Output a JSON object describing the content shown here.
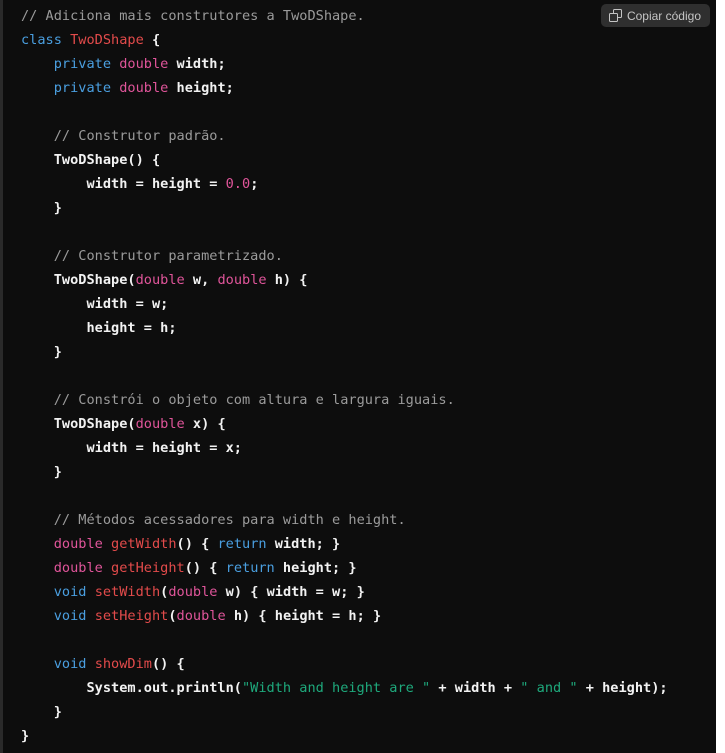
{
  "code_block": {
    "language": "java",
    "background_color": "#0d0d0d",
    "copy_button": {
      "label": "Copiar código",
      "icon": "copy-icon",
      "background_color": "#2f2f2f",
      "text_color": "#c5c5c5"
    },
    "syntax_colors": {
      "comment": "#9b9b9b",
      "keyword": "#4a9fe0",
      "type": "#e0559a",
      "class_name": "#e34b4b",
      "function": "#e34b4b",
      "string": "#1ea97c",
      "number": "#e0559a",
      "plain": "#f2f2f2"
    },
    "lines": [
      {
        "indent": 0,
        "tokens": [
          {
            "t": "comment",
            "v": "// Adiciona mais construtores a TwoDShape."
          }
        ]
      },
      {
        "indent": 0,
        "tokens": [
          {
            "t": "keyword",
            "v": "class"
          },
          {
            "t": "plain",
            "v": " "
          },
          {
            "t": "classname",
            "v": "TwoDShape"
          },
          {
            "t": "plain",
            "v": " {"
          }
        ]
      },
      {
        "indent": 1,
        "tokens": [
          {
            "t": "keyword",
            "v": "private"
          },
          {
            "t": "plain",
            "v": " "
          },
          {
            "t": "type",
            "v": "double"
          },
          {
            "t": "plain",
            "v": " width;"
          }
        ]
      },
      {
        "indent": 1,
        "tokens": [
          {
            "t": "keyword",
            "v": "private"
          },
          {
            "t": "plain",
            "v": " "
          },
          {
            "t": "type",
            "v": "double"
          },
          {
            "t": "plain",
            "v": " height;"
          }
        ]
      },
      {
        "indent": 0,
        "tokens": []
      },
      {
        "indent": 1,
        "tokens": [
          {
            "t": "comment",
            "v": "// Construtor padrão."
          }
        ]
      },
      {
        "indent": 1,
        "tokens": [
          {
            "t": "plain",
            "v": "TwoDShape() {"
          }
        ]
      },
      {
        "indent": 2,
        "tokens": [
          {
            "t": "plain",
            "v": "width = height = "
          },
          {
            "t": "number",
            "v": "0.0"
          },
          {
            "t": "plain",
            "v": ";"
          }
        ]
      },
      {
        "indent": 1,
        "tokens": [
          {
            "t": "plain",
            "v": "}"
          }
        ]
      },
      {
        "indent": 0,
        "tokens": []
      },
      {
        "indent": 1,
        "tokens": [
          {
            "t": "comment",
            "v": "// Construtor parametrizado."
          }
        ]
      },
      {
        "indent": 1,
        "tokens": [
          {
            "t": "plain",
            "v": "TwoDShape("
          },
          {
            "t": "type",
            "v": "double"
          },
          {
            "t": "plain",
            "v": " w, "
          },
          {
            "t": "type",
            "v": "double"
          },
          {
            "t": "plain",
            "v": " h) {"
          }
        ]
      },
      {
        "indent": 2,
        "tokens": [
          {
            "t": "plain",
            "v": "width = w;"
          }
        ]
      },
      {
        "indent": 2,
        "tokens": [
          {
            "t": "plain",
            "v": "height = h;"
          }
        ]
      },
      {
        "indent": 1,
        "tokens": [
          {
            "t": "plain",
            "v": "}"
          }
        ]
      },
      {
        "indent": 0,
        "tokens": []
      },
      {
        "indent": 1,
        "tokens": [
          {
            "t": "comment",
            "v": "// Constrói o objeto com altura e largura iguais."
          }
        ]
      },
      {
        "indent": 1,
        "tokens": [
          {
            "t": "plain",
            "v": "TwoDShape("
          },
          {
            "t": "type",
            "v": "double"
          },
          {
            "t": "plain",
            "v": " x) {"
          }
        ]
      },
      {
        "indent": 2,
        "tokens": [
          {
            "t": "plain",
            "v": "width = height = x;"
          }
        ]
      },
      {
        "indent": 1,
        "tokens": [
          {
            "t": "plain",
            "v": "}"
          }
        ]
      },
      {
        "indent": 0,
        "tokens": []
      },
      {
        "indent": 1,
        "tokens": [
          {
            "t": "comment",
            "v": "// Métodos acessadores para width e height."
          }
        ]
      },
      {
        "indent": 1,
        "tokens": [
          {
            "t": "type",
            "v": "double"
          },
          {
            "t": "plain",
            "v": " "
          },
          {
            "t": "fn",
            "v": "getWidth"
          },
          {
            "t": "plain",
            "v": "() { "
          },
          {
            "t": "keyword",
            "v": "return"
          },
          {
            "t": "plain",
            "v": " width; }"
          }
        ]
      },
      {
        "indent": 1,
        "tokens": [
          {
            "t": "type",
            "v": "double"
          },
          {
            "t": "plain",
            "v": " "
          },
          {
            "t": "fn",
            "v": "getHeight"
          },
          {
            "t": "plain",
            "v": "() { "
          },
          {
            "t": "keyword",
            "v": "return"
          },
          {
            "t": "plain",
            "v": " height; }"
          }
        ]
      },
      {
        "indent": 1,
        "tokens": [
          {
            "t": "keyword",
            "v": "void"
          },
          {
            "t": "plain",
            "v": " "
          },
          {
            "t": "fn",
            "v": "setWidth"
          },
          {
            "t": "plain",
            "v": "("
          },
          {
            "t": "type",
            "v": "double"
          },
          {
            "t": "plain",
            "v": " w) { width = w; }"
          }
        ]
      },
      {
        "indent": 1,
        "tokens": [
          {
            "t": "keyword",
            "v": "void"
          },
          {
            "t": "plain",
            "v": " "
          },
          {
            "t": "fn",
            "v": "setHeight"
          },
          {
            "t": "plain",
            "v": "("
          },
          {
            "t": "type",
            "v": "double"
          },
          {
            "t": "plain",
            "v": " h) { height = h; }"
          }
        ]
      },
      {
        "indent": 0,
        "tokens": []
      },
      {
        "indent": 1,
        "tokens": [
          {
            "t": "keyword",
            "v": "void"
          },
          {
            "t": "plain",
            "v": " "
          },
          {
            "t": "fn",
            "v": "showDim"
          },
          {
            "t": "plain",
            "v": "() {"
          }
        ]
      },
      {
        "indent": 2,
        "tokens": [
          {
            "t": "plain",
            "v": "System.out.println("
          },
          {
            "t": "string",
            "v": "\"Width and height are \""
          },
          {
            "t": "plain",
            "v": " + width + "
          },
          {
            "t": "string",
            "v": "\" and \""
          },
          {
            "t": "plain",
            "v": " + height);"
          }
        ]
      },
      {
        "indent": 1,
        "tokens": [
          {
            "t": "plain",
            "v": "}"
          }
        ]
      },
      {
        "indent": 0,
        "tokens": [
          {
            "t": "plain",
            "v": "}"
          }
        ]
      }
    ]
  }
}
